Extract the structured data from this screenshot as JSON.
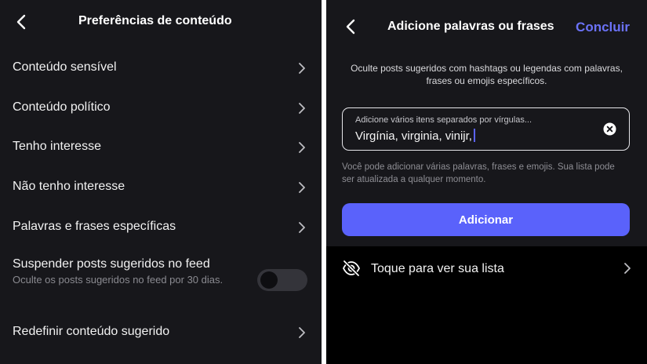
{
  "left": {
    "title": "Preferências de conteúdo",
    "rows": [
      {
        "label": "Conteúdo sensível"
      },
      {
        "label": "Conteúdo político"
      },
      {
        "label": "Tenho interesse"
      },
      {
        "label": "Não tenho interesse"
      },
      {
        "label": "Palavras e frases específicas"
      }
    ],
    "suspend": {
      "label": "Suspender posts sugeridos no feed",
      "sublabel": "Oculte os posts sugeridos no feed por 30 dias.",
      "enabled": false
    },
    "reset_label": "Redefinir conteúdo sugerido"
  },
  "right": {
    "title": "Adicione palavras ou frases",
    "done_label": "Concluir",
    "description": "Oculte posts sugeridos com hashtags ou legendas com palavras, frases ou emojis específicos.",
    "input": {
      "placeholder": "Adicione vários itens separados por vírgulas...",
      "value": "Virgínia, virginia, vinijr,"
    },
    "hint": "Você pode adicionar várias palavras, frases e emojis. Sua lista pode ser atualizada a qualquer momento.",
    "add_label": "Adicionar",
    "list_label": "Toque para ver sua lista"
  }
}
